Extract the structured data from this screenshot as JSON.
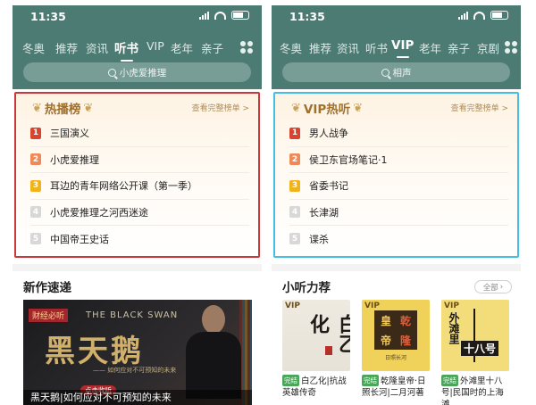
{
  "left": {
    "status_time": "11:35",
    "tabs": [
      "冬奥",
      "推荐",
      "资讯",
      "听书",
      "VIP",
      "老年",
      "亲子"
    ],
    "active_tab": "听书",
    "search_placeholder": "小虎爱推理",
    "card_title": "热播榜",
    "card_more": "查看完整榜单 >",
    "rank_items": [
      "三国演义",
      "小虎爱推理",
      "耳边的青年网络公开课（第一季）",
      "小虎爱推理之河西迷途",
      "中国帝王史话"
    ],
    "section_title": "新作速递",
    "banner": {
      "tag": "财经必听",
      "english": "THE BLACK SWAN",
      "big_title": "黑天鹅",
      "subtitle": "—— 如何应对不可预知的未来",
      "cta": "点击收听",
      "caption": "黑天鹅|如何应对不可预知的未来"
    }
  },
  "right": {
    "status_time": "11:35",
    "tabs": [
      "冬奥",
      "推荐",
      "资讯",
      "听书",
      "VIP",
      "老年",
      "亲子",
      "京剧"
    ],
    "active_tab": "VIP",
    "search_placeholder": "相声",
    "card_title": "VIP热听",
    "card_more": "查看完整榜单 >",
    "rank_items": [
      "男人战争",
      "侯卫东官场笔记·1",
      "省委书记",
      "长津湖",
      "谍杀"
    ],
    "section_title": "小听力荐",
    "all_label": "全部",
    "books": [
      {
        "vip": "VIP",
        "status": "完结",
        "title": "白乙化|抗战英雄传奇",
        "cover_text": "白乙化"
      },
      {
        "vip": "VIP",
        "status": "完结",
        "title": "乾隆皇帝·日照长河|二月河著",
        "cover_chars": [
          "皇",
          "乾",
          "帝",
          "隆"
        ],
        "cover_small": "日照长河"
      },
      {
        "vip": "VIP",
        "status": "完结",
        "title": "外滩里十八号|民国时的上海滩",
        "cover_top": "外滩里",
        "cover_num": "十八号"
      }
    ]
  },
  "colors": {
    "header": "#4b7b73",
    "left_card_border": "#c9383a",
    "right_card_border": "#45bfe1",
    "badge_1": "#d9442f",
    "badge_2": "#ee8a5a",
    "badge_3": "#f2b21c",
    "badge_rest": "#d8d8d8"
  },
  "icons": {
    "search": "magnifier-icon",
    "grid": "category-grid-icon",
    "laurel": "laurel-icon"
  }
}
